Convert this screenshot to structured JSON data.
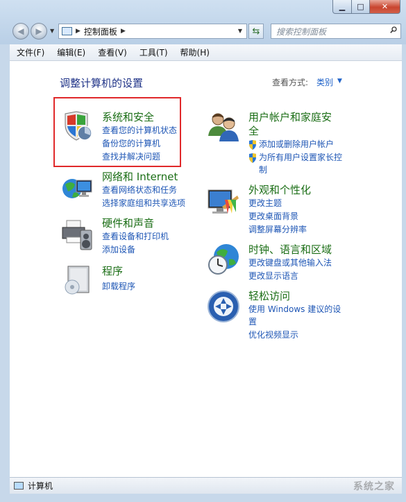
{
  "window": {
    "address_path": "控制面板",
    "search_placeholder": "搜索控制面板"
  },
  "menu": [
    "文件(F)",
    "编辑(E)",
    "查看(V)",
    "工具(T)",
    "帮助(H)"
  ],
  "heading": "调整计算机的设置",
  "view": {
    "label": "查看方式:",
    "value": "类别"
  },
  "categories": {
    "system": {
      "title": "系统和安全",
      "links": [
        "查看您的计算机状态",
        "备份您的计算机",
        "查找并解决问题"
      ]
    },
    "network": {
      "title": "网络和 Internet",
      "links": [
        "查看网络状态和任务",
        "选择家庭组和共享选项"
      ]
    },
    "hardware": {
      "title": "硬件和声音",
      "links": [
        "查看设备和打印机",
        "添加设备"
      ]
    },
    "programs": {
      "title": "程序",
      "links": [
        "卸载程序"
      ]
    },
    "users": {
      "title_line1": "用户帐户和家庭安",
      "title_line2": "全",
      "link1": "添加或删除用户帐户",
      "link2_line1": "为所有用户设置家长控",
      "link2_line2": "制"
    },
    "appearance": {
      "title": "外观和个性化",
      "links": [
        "更改主题",
        "更改桌面背景",
        "调整屏幕分辨率"
      ]
    },
    "clock": {
      "title": "时钟、语言和区域",
      "links": [
        "更改键盘或其他输入法",
        "更改显示语言"
      ]
    },
    "ease": {
      "title": "轻松访问",
      "link1_line1": "使用 Windows 建议的设",
      "link1_line2": "置",
      "link2": "优化视频显示"
    }
  },
  "status": {
    "text": "计算机",
    "watermark": "系统之家"
  },
  "colors": {
    "title_green": "#1b6e16",
    "link_blue": "#1e56b5",
    "highlight_red": "#e0282a",
    "heading_navy": "#1e3287"
  }
}
